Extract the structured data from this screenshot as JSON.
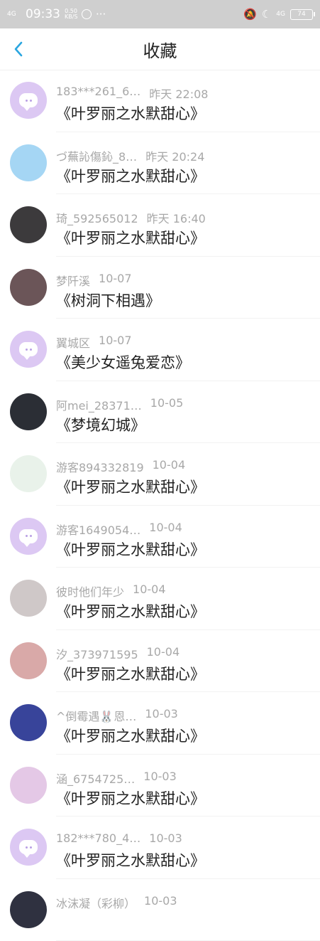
{
  "status_bar": {
    "signal": "4G",
    "time": "09:33",
    "net_speed_value": "0.50",
    "net_speed_unit": "KB/S",
    "more": "···",
    "right_network": "4G",
    "battery": "74"
  },
  "header": {
    "title": "收藏",
    "back_icon": "chevron-left-icon"
  },
  "accent_color": "#2aa6e0",
  "items": [
    {
      "name": "183***261_6…",
      "time": "昨天 22:08",
      "title": "《叶罗丽之水默甜心》",
      "avatar": "default",
      "avatar_color": "#dcc8f3"
    },
    {
      "name": "づ蕪訫傷鈊_8…",
      "time": "昨天 20:24",
      "title": "《叶罗丽之水默甜心》",
      "avatar": "photo",
      "avatar_color": "#a5d6f4"
    },
    {
      "name": "琦_592565012",
      "time": "昨天 16:40",
      "title": "《叶罗丽之水默甜心》",
      "avatar": "photo",
      "avatar_color": "#3c3a3c"
    },
    {
      "name": "梦阡溪",
      "time": "10-07",
      "title": "《树洞下相遇》",
      "avatar": "photo",
      "avatar_color": "#6b5558"
    },
    {
      "name": "翼城区",
      "time": "10-07",
      "title": "《美少女遥兔爱恋》",
      "avatar": "default",
      "avatar_color": "#dcc8f3"
    },
    {
      "name": "阿mei_28371…",
      "time": "10-05",
      "title": "《梦境幻城》",
      "avatar": "photo",
      "avatar_color": "#2b2e35"
    },
    {
      "name": "游客894332819",
      "time": "10-04",
      "title": "《叶罗丽之水默甜心》",
      "avatar": "photo",
      "avatar_color": "#e9f2ea"
    },
    {
      "name": "游客1649054…",
      "time": "10-04",
      "title": "《叶罗丽之水默甜心》",
      "avatar": "default",
      "avatar_color": "#dcc8f3"
    },
    {
      "name": "彼时他们年少",
      "time": "10-04",
      "title": "《叶罗丽之水默甜心》",
      "avatar": "photo",
      "avatar_color": "#cfc8c8"
    },
    {
      "name": "汐_373971595",
      "time": "10-04",
      "title": "《叶罗丽之水默甜心》",
      "avatar": "photo",
      "avatar_color": "#d9a9a8"
    },
    {
      "name": "^倒霉遇🐰恩…",
      "time": "10-03",
      "title": "《叶罗丽之水默甜心》",
      "avatar": "photo",
      "avatar_color": "#38449a"
    },
    {
      "name": "涵_6754725…",
      "time": "10-03",
      "title": "《叶罗丽之水默甜心》",
      "avatar": "photo",
      "avatar_color": "#e4c8e6"
    },
    {
      "name": "182***780_4…",
      "time": "10-03",
      "title": "《叶罗丽之水默甜心》",
      "avatar": "default",
      "avatar_color": "#dcc8f3"
    },
    {
      "name": "冰沫凝（彩柳）",
      "time": "10-03",
      "title": "",
      "avatar": "photo",
      "avatar_color": "#2f3140"
    }
  ]
}
